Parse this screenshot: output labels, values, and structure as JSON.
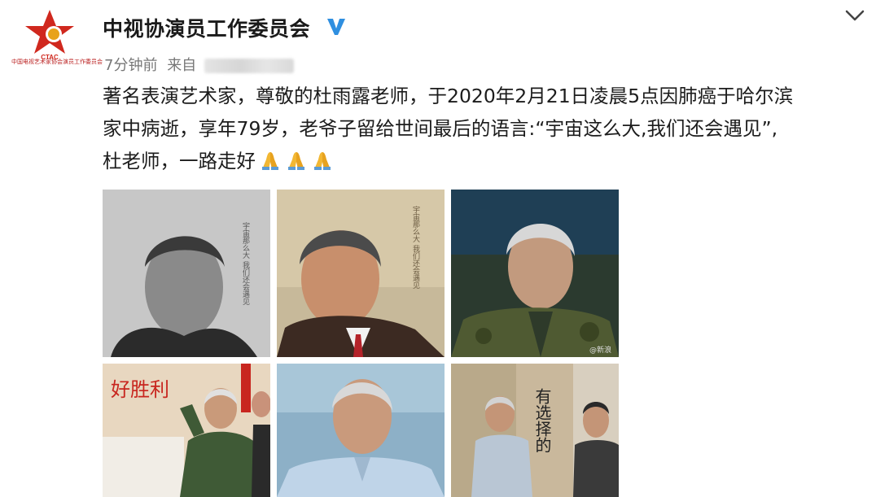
{
  "account": {
    "name": "中视协演员工作委员会",
    "logo_text": "CTAC",
    "logo_caption": "中国电视艺术家协会演员工作委员会",
    "verified_icon": "verified-badge-icon",
    "brand_color": "#d0281e",
    "verified_color": "#2f8fe0"
  },
  "meta": {
    "time": "7分钟前",
    "source_prefix": "来自"
  },
  "post": {
    "lines": [
      "著名表演艺术家，尊敬的杜雨露老师，于2020年2月21日凌晨5点因肺癌于哈尔滨",
      "家中病逝，享年79岁，老爷子留给世间最后的语言:“宇宙这么大,我们还会遇见”,",
      "杜老师，一路走好"
    ],
    "emoji": [
      "🙏",
      "🙏",
      "🙏"
    ]
  },
  "photos": [
    {
      "name": "bw-portrait",
      "overlay_text": "宇宙那么大 我们还会遇见"
    },
    {
      "name": "suit-portrait",
      "overlay_text": "宇宙那么大 我们还会遇见"
    },
    {
      "name": "military-uniform",
      "overlay_text": "@新浪"
    },
    {
      "name": "salute-photo",
      "overlay_text": "好胜利"
    },
    {
      "name": "smiling-portrait",
      "overlay_text": ""
    },
    {
      "name": "drama-still",
      "overlay_text": "有选择的"
    }
  ]
}
